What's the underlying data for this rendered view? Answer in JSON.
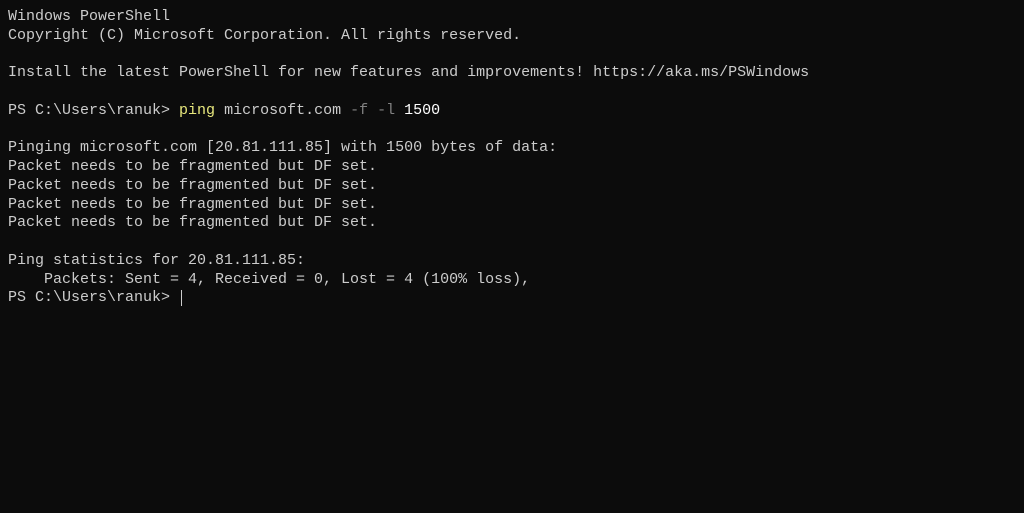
{
  "header": {
    "title": "Windows PowerShell",
    "copyright": "Copyright (C) Microsoft Corporation. All rights reserved."
  },
  "install_msg": "Install the latest PowerShell for new features and improvements! https://aka.ms/PSWindows",
  "prompt1": {
    "prefix": "PS C:\\Users\\ranuk> ",
    "cmd": "ping",
    "sp1": " ",
    "target": "microsoft.com",
    "sp2": " ",
    "flags": "-f -l",
    "sp3": " ",
    "size": "1500"
  },
  "ping_header": "Pinging microsoft.com [20.81.111.85] with 1500 bytes of data:",
  "ping_responses": [
    "Packet needs to be fragmented but DF set.",
    "Packet needs to be fragmented but DF set.",
    "Packet needs to be fragmented but DF set.",
    "Packet needs to be fragmented but DF set."
  ],
  "stats_header": "Ping statistics for 20.81.111.85:",
  "stats_packets": "    Packets: Sent = 4, Received = 0, Lost = 4 (100% loss),",
  "prompt2": {
    "prefix": "PS C:\\Users\\ranuk> "
  }
}
